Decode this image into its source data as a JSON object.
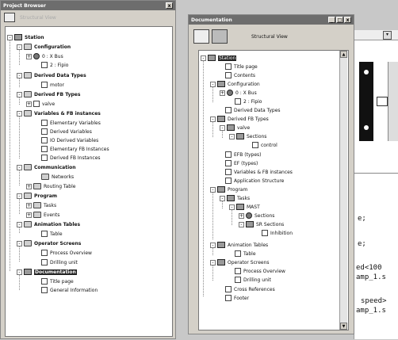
{
  "project_browser": {
    "title": "Project Browser",
    "close_label": "x",
    "view_label": "Structural View"
  },
  "project_tree": [
    {
      "label": "Station",
      "bold": true
    },
    {
      "label": "Configuration",
      "bold": true
    },
    {
      "label": "0 : X Bus",
      "bold": false
    },
    {
      "label": "2 : Fipio",
      "bold": false
    },
    {
      "label": "Derived Data Types",
      "bold": true
    },
    {
      "label": "motor",
      "bold": false
    },
    {
      "label": "Derived FB Types",
      "bold": true
    },
    {
      "label": "valve",
      "bold": false
    },
    {
      "label": "Variables & FB instances",
      "bold": true
    },
    {
      "label": "Elementary Variables",
      "bold": false
    },
    {
      "label": "Derived Variables",
      "bold": false
    },
    {
      "label": "IO Derived Variables",
      "bold": false
    },
    {
      "label": "Elementary FB Instances",
      "bold": false
    },
    {
      "label": "Derived FB Instances",
      "bold": false
    },
    {
      "label": "Communication",
      "bold": true
    },
    {
      "label": "Networks",
      "bold": false
    },
    {
      "label": "Routing Table",
      "bold": false
    },
    {
      "label": "Program",
      "bold": true
    },
    {
      "label": "Tasks",
      "bold": false
    },
    {
      "label": "Events",
      "bold": false
    },
    {
      "label": "Animation Tables",
      "bold": true
    },
    {
      "label": "Table",
      "bold": false
    },
    {
      "label": "Operator Screens",
      "bold": true
    },
    {
      "label": "Process Overview",
      "bold": false
    },
    {
      "label": "Drilling unit",
      "bold": false
    },
    {
      "label": "Documentation",
      "bold": true
    },
    {
      "label": "Title page",
      "bold": false
    },
    {
      "label": "General Information",
      "bold": false
    }
  ],
  "documentation": {
    "title": "Documentation",
    "view_label": "Structural View",
    "min_label": "_",
    "max_label": "□",
    "close_label": "x"
  },
  "doc_tree": [
    {
      "label": "Station"
    },
    {
      "label": "Title page"
    },
    {
      "label": "Contents"
    },
    {
      "label": "Configuration"
    },
    {
      "label": "0 : X Bus"
    },
    {
      "label": "2 : Fipio"
    },
    {
      "label": "Derived Data Types"
    },
    {
      "label": "Derived FB Types"
    },
    {
      "label": "valve"
    },
    {
      "label": "Sections"
    },
    {
      "label": "control"
    },
    {
      "label": "EFB (types)"
    },
    {
      "label": "EF (types)"
    },
    {
      "label": "Variables & FB instances"
    },
    {
      "label": "Application Structure"
    },
    {
      "label": "Program"
    },
    {
      "label": "Tasks"
    },
    {
      "label": "MAST"
    },
    {
      "label": "Sections"
    },
    {
      "label": "SR Sections"
    },
    {
      "label": "Inhibition"
    },
    {
      "label": "Animation Tables"
    },
    {
      "label": "Table"
    },
    {
      "label": "Operator Screens"
    },
    {
      "label": "Process Overview"
    },
    {
      "label": "Drilling unit"
    },
    {
      "label": "Cross References"
    },
    {
      "label": "Footer"
    }
  ],
  "background_code": {
    "lines": [
      "e;",
      "e;",
      "ed<100",
      "amp_1.s",
      "speed>",
      "amp_1.s"
    ]
  }
}
